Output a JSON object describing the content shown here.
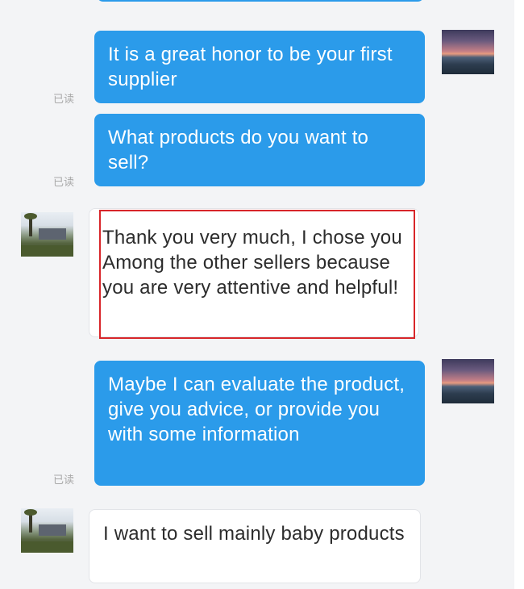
{
  "messages": [
    {
      "side": "out",
      "text": "It is a great honor to be your first supplier",
      "read_label": "已读"
    },
    {
      "side": "out",
      "text": "What products do you want to sell?",
      "read_label": "已读"
    },
    {
      "side": "in",
      "text": "Thank you very much, I chose you Among the other sellers because you are very attentive and helpful!",
      "highlighted": true
    },
    {
      "side": "out",
      "text": "Maybe I can evaluate the product, give you advice, or provide you with some information",
      "read_label": "已读"
    },
    {
      "side": "in",
      "text": "I want to sell mainly baby products"
    }
  ],
  "colors": {
    "outgoing_bubble": "#2b9bea",
    "incoming_bubble": "#ffffff",
    "highlight_border": "#d8262a",
    "read_label": "#a9a9a9",
    "background": "#f3f4f6"
  },
  "icons": {
    "self_avatar": "sunset-avatar",
    "other_avatar": "landscape-avatar"
  }
}
